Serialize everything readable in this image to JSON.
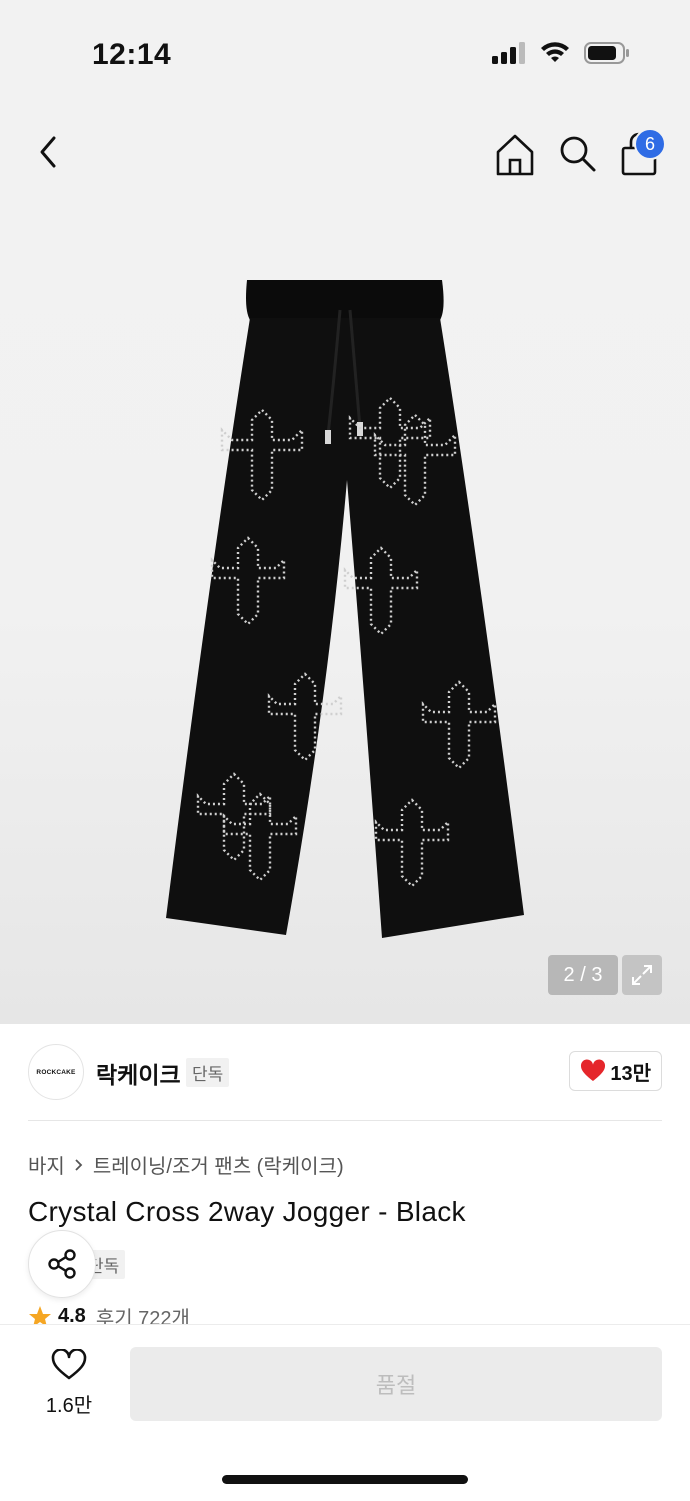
{
  "status_bar": {
    "time": "12:14"
  },
  "nav": {
    "cart_count": "6",
    "icons": [
      "back-icon",
      "home-icon",
      "search-icon",
      "shopping-bag-icon"
    ]
  },
  "gallery": {
    "counter": "2 / 3"
  },
  "brand": {
    "logo_text": "ROCKCAKE",
    "name": "락케이크",
    "exclusive_tag": "단독",
    "likes": "13만"
  },
  "breadcrumb": {
    "category": "바지",
    "subcategory": "트레이닝/조거 팬츠 (락케이크)"
  },
  "product": {
    "title": "Crystal Cross 2way Jogger - Black",
    "exclusive_tag": "단독",
    "rating": "4.8",
    "reviews": "후기 722개"
  },
  "bottom_bar": {
    "wish_count": "1.6만",
    "soldout_label": "품절"
  },
  "colors": {
    "accent": "#2f6ce5",
    "heart": "#e5262b",
    "star": "#f5a623"
  }
}
